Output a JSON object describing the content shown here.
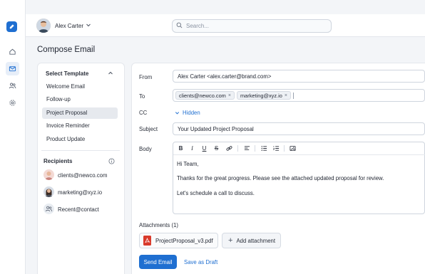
{
  "user": {
    "name": "Alex Carter"
  },
  "search": {
    "placeholder": "Search..."
  },
  "page_title": "Compose Email",
  "templates": {
    "title": "Select Template",
    "items": [
      "Welcome Email",
      "Follow-up",
      "Project Proposal",
      "Invoice Reminder",
      "Product Update"
    ],
    "selected": "Project Proposal"
  },
  "recipients": {
    "title": "Recipients",
    "items": [
      "clients@newco.com",
      "marketing@xyz.io",
      "Recent@contact"
    ]
  },
  "form": {
    "from_label": "From",
    "from_value": "Alex Carter <alex.carter@brand.com>",
    "to_label": "To",
    "to_chips": [
      "clients@newco.com",
      "marketing@xyz.io"
    ],
    "chip_remove": "×",
    "cc_label": "CC",
    "cc_toggle": "Hidden",
    "subject_label": "Subject",
    "subject_value": "Your Updated Project Proposal",
    "body_label": "Body",
    "body_lines": [
      "Hi Team,",
      "Thanks for the great progress. Please see the attached updated proposal for review.",
      "Let's schedule a call to discuss."
    ]
  },
  "toolbar": {
    "bold": "B",
    "italic": "I",
    "underline": "U",
    "strike": "S"
  },
  "attachments": {
    "label": "Attachments (1)",
    "files": [
      "ProjectProposal_v3.pdf"
    ],
    "add_label": "Add attachment",
    "add_symbol": "+"
  },
  "actions": {
    "send": "Send Email",
    "draft": "Save as Draft"
  },
  "colors": {
    "accent": "#1f6fd1",
    "pdf": "#d93a2b",
    "selected_bg": "#e6e9ee"
  }
}
